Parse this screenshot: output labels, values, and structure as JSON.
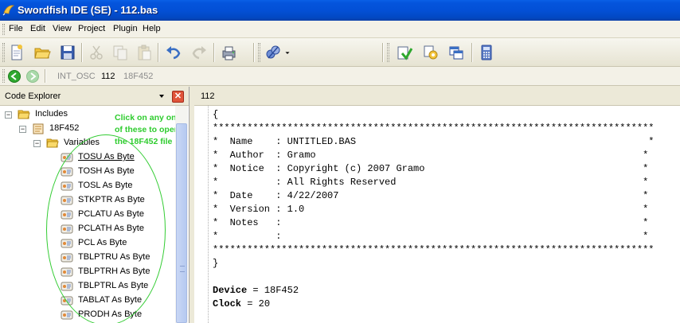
{
  "window": {
    "title": "Swordfish IDE (SE) - 112.bas"
  },
  "menu": [
    "File",
    "Edit",
    "View",
    "Project",
    "Plugin",
    "Help"
  ],
  "toolbar_icons": [
    "new-file-icon",
    "open-folder-icon",
    "save-icon",
    "cut-icon",
    "copy-icon",
    "paste-icon",
    "undo-icon",
    "redo-icon",
    "print-icon",
    "compile-icon",
    "program-icon",
    "options-icon",
    "windows-icon",
    "calculator-icon"
  ],
  "navbar": {
    "crumb1": "INT_OSC",
    "crumb2": "112",
    "crumb3": "18F452"
  },
  "explorer": {
    "title": "Code Explorer",
    "close_glyph": "✕",
    "includes_label": "Includes",
    "device_label": "18F452",
    "variables_label": "Variables",
    "variables": [
      "TOSU As Byte",
      "TOSH As Byte",
      "TOSL As Byte",
      "STKPTR As Byte",
      "PCLATU As Byte",
      "PCLATH As Byte",
      "PCL As Byte",
      "TBLPTRU As Byte",
      "TBLPTRH As Byte",
      "TBLPTRL As Byte",
      "TABLAT As Byte",
      "PRODH As Byte"
    ]
  },
  "annotation": {
    "text": "Click on any one of these to open the 18F452 file",
    "color": "#33cc33"
  },
  "editor": {
    "tab_label": "112",
    "lines": [
      "{",
      "*****************************************************************************",
      "*  Name    : UNTITLED.BAS                                                   *",
      "*  Author  : Gramo                                                         *",
      "*  Notice  : Copyright (c) 2007 Gramo                                      *",
      "*          : All Rights Reserved                                           *",
      "*  Date    : 4/22/2007                                                     *",
      "*  Version : 1.0                                                           *",
      "*  Notes   :                                                               *",
      "*          :                                                               *",
      "*****************************************************************************",
      "}",
      "",
      "Device = 18F452",
      "Clock = 20"
    ],
    "keyword_device": "Device",
    "keyword_clock": "Clock"
  },
  "colors": {
    "titlebar": "#0350d6",
    "annotation": "#33cc33",
    "close_button": "#e0543a"
  }
}
